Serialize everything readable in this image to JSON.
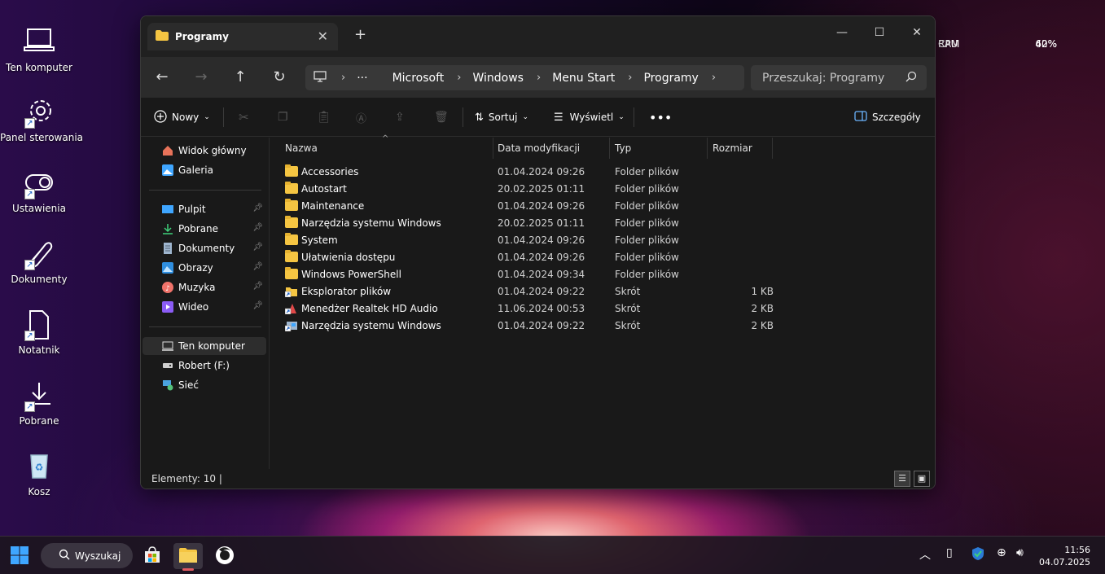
{
  "desktop": {
    "icons": [
      {
        "label": "Ten komputer",
        "icon": "computer-icon"
      },
      {
        "label": "Panel sterowania",
        "icon": "gear-icon"
      },
      {
        "label": "Ustawienia",
        "icon": "toggle-icon"
      },
      {
        "label": "Dokumenty",
        "icon": "paperclip-icon"
      },
      {
        "label": "Notatnik",
        "icon": "document-icon"
      },
      {
        "label": "Pobrane",
        "icon": "download-icon"
      },
      {
        "label": "Kosz",
        "icon": "recycle-bin-icon"
      }
    ]
  },
  "monitor": {
    "cpu_label": "CPU",
    "cpu_value": "42%",
    "ram_label": "RAM",
    "ram_value": "60%"
  },
  "window": {
    "tab_title": "Programy",
    "new_tab": "+",
    "breadcrumb": [
      "Microsoft",
      "Windows",
      "Menu Start",
      "Programy"
    ],
    "search_placeholder": "Przeszukaj: Programy",
    "toolbar": {
      "new_label": "Nowy",
      "sort_label": "Sortuj",
      "view_label": "Wyświetl",
      "details_label": "Szczegóły"
    },
    "sidebar": {
      "top": [
        {
          "label": "Widok główny",
          "icon": "home-icon"
        },
        {
          "label": "Galeria",
          "icon": "gallery-icon"
        }
      ],
      "pinned": [
        {
          "label": "Pulpit",
          "icon": "desktop-icon"
        },
        {
          "label": "Pobrane",
          "icon": "download-icon"
        },
        {
          "label": "Dokumenty",
          "icon": "document-icon"
        },
        {
          "label": "Obrazy",
          "icon": "pictures-icon"
        },
        {
          "label": "Muzyka",
          "icon": "music-icon"
        },
        {
          "label": "Wideo",
          "icon": "video-icon"
        }
      ],
      "drives": [
        {
          "label": "Ten komputer",
          "icon": "computer-icon"
        },
        {
          "label": "Robert (F:)",
          "icon": "drive-icon"
        },
        {
          "label": "Sieć",
          "icon": "network-icon"
        }
      ]
    },
    "columns": {
      "name": "Nazwa",
      "date": "Data modyfikacji",
      "type": "Typ",
      "size": "Rozmiar"
    },
    "files": [
      {
        "name": "Accessories",
        "date": "01.04.2024 09:26",
        "type": "Folder plików",
        "size": "",
        "kind": "folder"
      },
      {
        "name": "Autostart",
        "date": "20.02.2025 01:11",
        "type": "Folder plików",
        "size": "",
        "kind": "folder"
      },
      {
        "name": "Maintenance",
        "date": "01.04.2024 09:26",
        "type": "Folder plików",
        "size": "",
        "kind": "folder"
      },
      {
        "name": "Narzędzia systemu Windows",
        "date": "20.02.2025 01:11",
        "type": "Folder plików",
        "size": "",
        "kind": "folder"
      },
      {
        "name": "System",
        "date": "01.04.2024 09:26",
        "type": "Folder plików",
        "size": "",
        "kind": "folder"
      },
      {
        "name": "Ułatwienia dostępu",
        "date": "01.04.2024 09:26",
        "type": "Folder plików",
        "size": "",
        "kind": "folder"
      },
      {
        "name": "Windows PowerShell",
        "date": "01.04.2024 09:34",
        "type": "Folder plików",
        "size": "",
        "kind": "folder"
      },
      {
        "name": "Eksplorator plików",
        "date": "01.04.2024 09:22",
        "type": "Skrót",
        "size": "1 KB",
        "kind": "shortcut"
      },
      {
        "name": "Menedżer Realtek HD Audio",
        "date": "11.06.2024 00:53",
        "type": "Skrót",
        "size": "2 KB",
        "kind": "shortcut"
      },
      {
        "name": "Narzędzia systemu Windows",
        "date": "01.04.2024 09:22",
        "type": "Skrót",
        "size": "2 KB",
        "kind": "shortcut"
      }
    ],
    "status": "Elementy: 10  |"
  },
  "taskbar": {
    "search_label": "Wyszukaj",
    "time": "11:56",
    "date": "04.07.2025"
  }
}
